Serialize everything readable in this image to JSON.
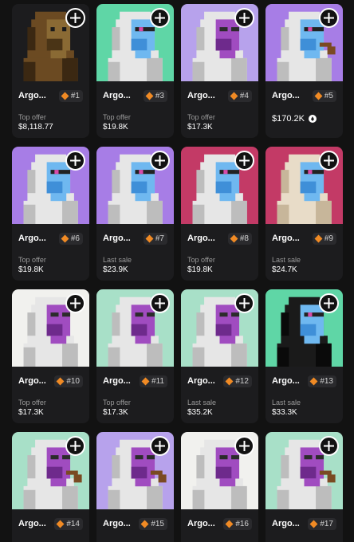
{
  "cards": [
    {
      "name": "Argo...",
      "rank": "#1",
      "label": "Top offer",
      "price": "$8,118.77",
      "bg": "#1c1c1e",
      "variant": "brown"
    },
    {
      "name": "Argo...",
      "rank": "#3",
      "label": "Top offer",
      "price": "$19.8K",
      "bg": "#5fd6a6",
      "variant": "blue"
    },
    {
      "name": "Argo...",
      "rank": "#4",
      "label": "Top offer",
      "price": "$17.3K",
      "bg": "#b7a2ec",
      "variant": "purple"
    },
    {
      "name": "Argo...",
      "rank": "#5",
      "label": "",
      "price": "$170.2K",
      "bg": "#a77de6",
      "variant": "blue-pipe",
      "eth": true
    },
    {
      "name": "Argo...",
      "rank": "#6",
      "label": "Top offer",
      "price": "$19.8K",
      "bg": "#a77de6",
      "variant": "blue"
    },
    {
      "name": "Argo...",
      "rank": "#7",
      "label": "Last sale",
      "price": "$23.9K",
      "bg": "#a77de6",
      "variant": "blue"
    },
    {
      "name": "Argo...",
      "rank": "#8",
      "label": "Top offer",
      "price": "$19.8K",
      "bg": "#c33a66",
      "variant": "blue"
    },
    {
      "name": "Argo...",
      "rank": "#9",
      "label": "Last sale",
      "price": "$24.7K",
      "bg": "#c33a66",
      "variant": "blue-beige"
    },
    {
      "name": "Argo...",
      "rank": "#10",
      "label": "Top offer",
      "price": "$17.3K",
      "bg": "#f1f1ee",
      "variant": "purple"
    },
    {
      "name": "Argo...",
      "rank": "#11",
      "label": "Top offer",
      "price": "$17.3K",
      "bg": "#a8e0c8",
      "variant": "purple"
    },
    {
      "name": "Argo...",
      "rank": "#12",
      "label": "Last sale",
      "price": "$35.2K",
      "bg": "#a8e0c8",
      "variant": "purple"
    },
    {
      "name": "Argo...",
      "rank": "#13",
      "label": "Last sale",
      "price": "$33.3K",
      "bg": "#5fd6a6",
      "variant": "black"
    },
    {
      "name": "Argo...",
      "rank": "#14",
      "label": "",
      "price": "",
      "bg": "#a8e0c8",
      "variant": "purple-pipe"
    },
    {
      "name": "Argo...",
      "rank": "#15",
      "label": "",
      "price": "",
      "bg": "#b7a2ec",
      "variant": "purple-pipe"
    },
    {
      "name": "Argo...",
      "rank": "#16",
      "label": "",
      "price": "",
      "bg": "#f1f1ee",
      "variant": "purple"
    },
    {
      "name": "Argo...",
      "rank": "#17",
      "label": "",
      "price": "",
      "bg": "#a8e0c8",
      "variant": "purple-pipe"
    }
  ],
  "icons": {
    "add": "plus-icon",
    "rank": "diamond-icon",
    "currency": "eth-icon"
  },
  "colors": {
    "accent": "#f08a24",
    "background": "#121212",
    "card": "#1c1c1e"
  }
}
